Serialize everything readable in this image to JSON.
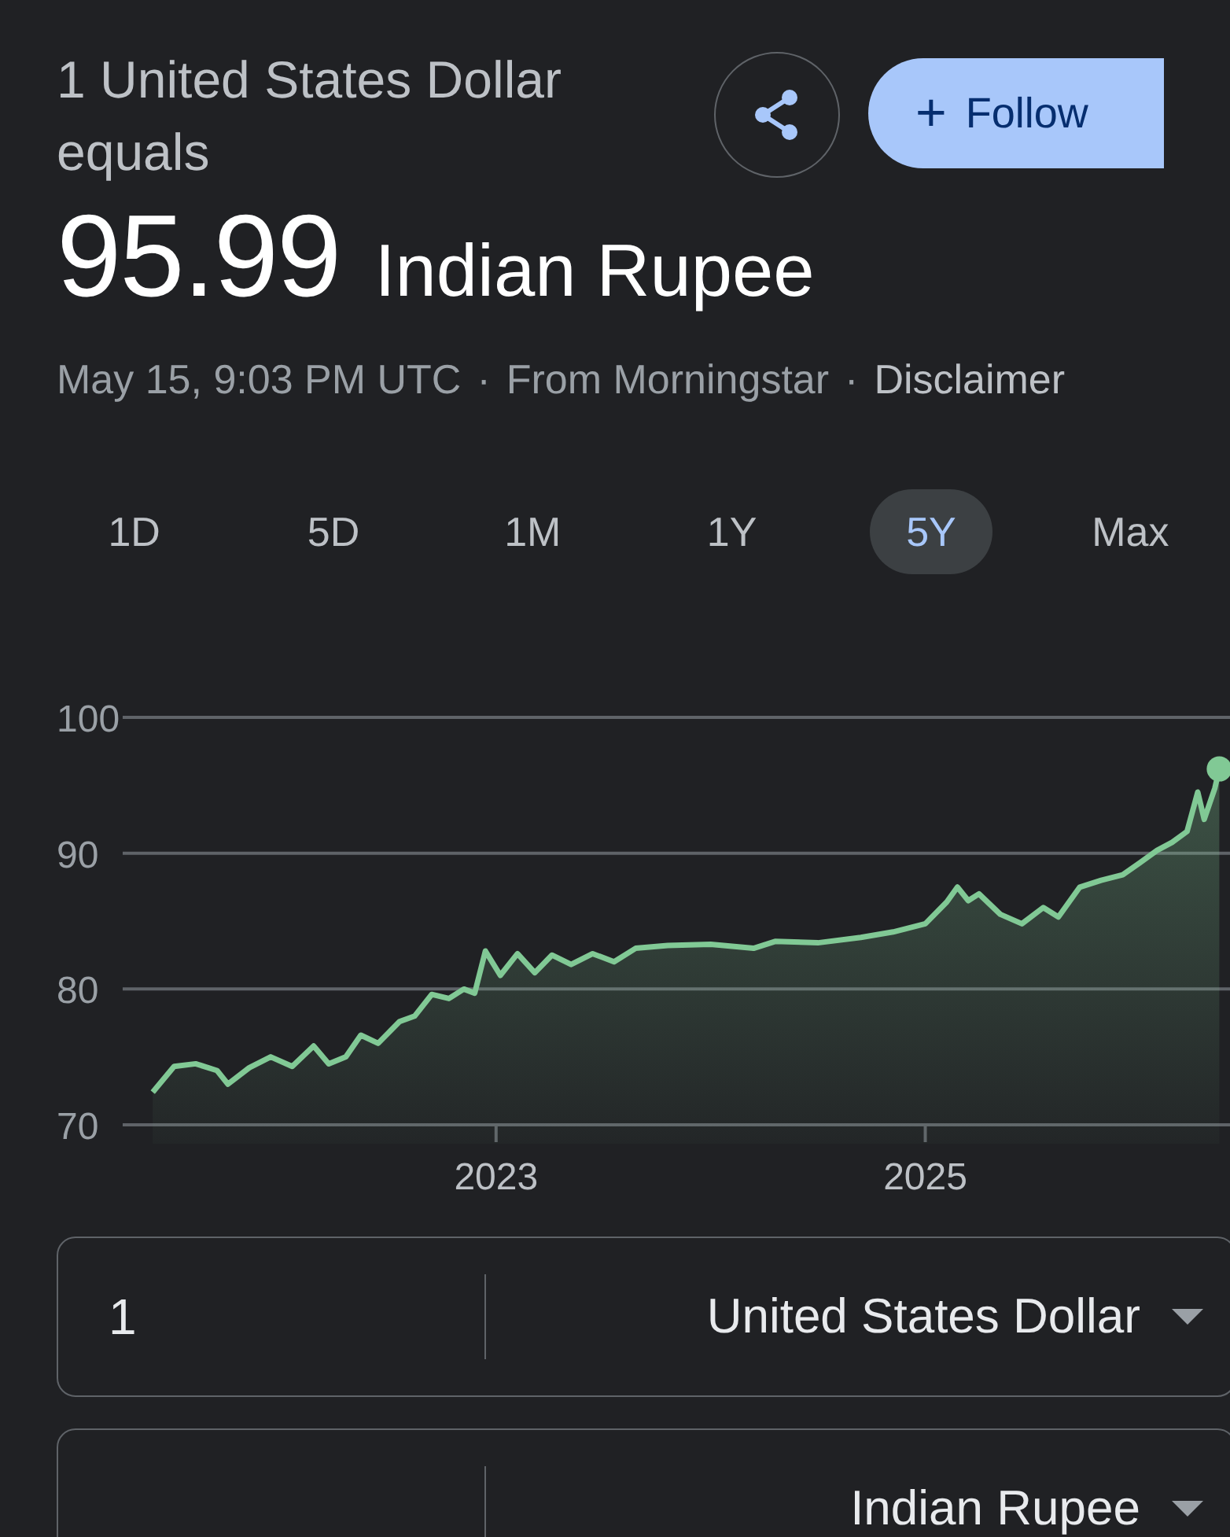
{
  "header": {
    "caption": "1 United States Dollar equals",
    "rate": "95.99",
    "currency": "Indian Rupee",
    "follow_button": {
      "icon": "+",
      "label": "Follow"
    }
  },
  "meta": [
    {
      "text": "May 15, 9:03 PM UTC"
    },
    {
      "text": "·"
    },
    {
      "text": "From Morningstar"
    },
    {
      "text": "·"
    },
    {
      "text": "Disclaimer",
      "kind": "link"
    }
  ],
  "ranges": [
    {
      "label": "1D",
      "selected": false
    },
    {
      "label": "5D",
      "selected": false
    },
    {
      "label": "1M",
      "selected": false
    },
    {
      "label": "1Y",
      "selected": false
    },
    {
      "label": "5Y",
      "selected": true
    },
    {
      "label": "Max",
      "selected": false
    }
  ],
  "chart_data": {
    "type": "area",
    "x": [
      2021.4,
      2021.5,
      2021.6,
      2021.7,
      2021.75,
      2021.85,
      2021.95,
      2022.05,
      2022.15,
      2022.22,
      2022.3,
      2022.37,
      2022.45,
      2022.55,
      2022.62,
      2022.7,
      2022.78,
      2022.85,
      2022.9,
      2022.95,
      2023.02,
      2023.1,
      2023.18,
      2023.26,
      2023.35,
      2023.45,
      2023.55,
      2023.65,
      2023.8,
      2024.0,
      2024.2,
      2024.3,
      2024.5,
      2024.7,
      2024.85,
      2025.0,
      2025.1,
      2025.15,
      2025.2,
      2025.25,
      2025.35,
      2025.45,
      2025.55,
      2025.62,
      2025.72,
      2025.82,
      2025.92,
      2026.0,
      2026.08,
      2026.15,
      2026.22,
      2026.27,
      2026.3,
      2026.35,
      2026.37
    ],
    "series": [
      {
        "color": "#81c995",
        "values": [
          72.4,
          74.3,
          74.5,
          74.0,
          73.0,
          74.2,
          75.0,
          74.3,
          75.8,
          74.5,
          75.0,
          76.6,
          76.0,
          77.6,
          78.0,
          79.6,
          79.3,
          80.0,
          79.7,
          82.8,
          81.0,
          82.6,
          81.2,
          82.5,
          81.8,
          82.6,
          82.0,
          83.0,
          83.2,
          83.3,
          83.0,
          83.5,
          83.4,
          83.8,
          84.2,
          84.8,
          86.4,
          87.5,
          86.5,
          87.0,
          85.5,
          84.8,
          86.0,
          85.3,
          87.5,
          88.0,
          88.4,
          89.3,
          90.2,
          90.8,
          91.6,
          94.5,
          92.5,
          94.8,
          96.2
        ]
      }
    ],
    "xlim": [
      2021.26,
      2026.42
    ],
    "ylim": [
      70,
      100
    ],
    "yticks": [
      70,
      80,
      90,
      100
    ],
    "xticks": [
      2023,
      2025
    ]
  },
  "converter": [
    {
      "amount": "1",
      "currency": "United States Dollar"
    },
    {
      "currency": "Indian Rupee"
    }
  ]
}
